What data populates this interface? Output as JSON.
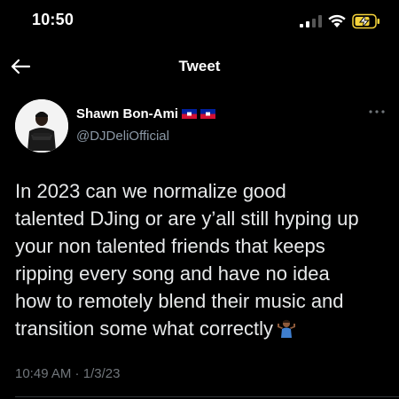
{
  "status_bar": {
    "time": "10:50",
    "signal_icon": "cellular-signal-icon",
    "wifi_icon": "wifi-icon",
    "battery_icon": "battery-charging-icon",
    "battery_color": "#f5d33b"
  },
  "nav": {
    "back_icon": "arrow-left-icon",
    "title": "Tweet"
  },
  "tweet": {
    "author": {
      "display_name": "Shawn Bon-Ami",
      "handle": "@DJDeliOfficial",
      "flags": [
        "haiti-flag",
        "haiti-flag"
      ]
    },
    "more_icon": "more-horizontal-icon",
    "text": "In 2023 can we normalize good\ntalented DJing or are y’all still hyping up\nyour non talented friends that keeps\nripping every song and have no idea\nhow to remotely blend their music and\ntransition some what correctly",
    "trailing_emoji": "person-shrugging-emoji",
    "time": "10:49 AM",
    "separator": " · ",
    "date": "1/3/23"
  },
  "colors": {
    "background": "#000000",
    "text_primary": "#e7e9ea",
    "text_secondary": "#71767b",
    "divider": "#2f3336"
  }
}
